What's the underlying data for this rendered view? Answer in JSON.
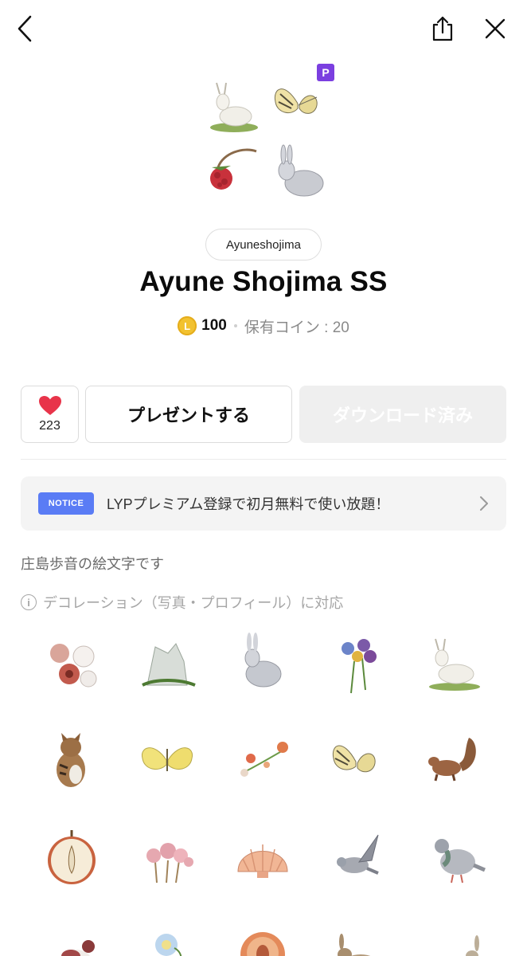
{
  "topbar": {
    "back_icon": "chevron-left-icon",
    "share_icon": "share-icon",
    "close_icon": "close-icon"
  },
  "hero": {
    "images": [
      "white-goat-sticker",
      "butterfly-sticker",
      "raspberry-sticker",
      "rabbit-sticker"
    ],
    "premium_badge": "P"
  },
  "author": "Ayuneshojima",
  "title": "Ayune Shojima SS",
  "price": {
    "coin_symbol": "L",
    "amount": "100",
    "owned": "保有コイン : 20"
  },
  "actions": {
    "like_count": "223",
    "present_label": "プレゼントする",
    "download_label": "ダウンロード済み"
  },
  "notice": {
    "badge": "NOTICE",
    "text": "LYPプレミアム登録で初月無料で使い放題！"
  },
  "description": "庄島歩音の絵文字です",
  "decoration": {
    "icon": "info-icon",
    "text": "デコレーション（写真・プロフィール）に対応"
  },
  "emoji_grid": [
    "flowers-emoji",
    "doves-emoji",
    "rabbit-emoji",
    "pansy-emoji",
    "goat-emoji",
    "cat-emoji",
    "yellow-butterfly-emoji",
    "flower-sprig-emoji",
    "swallowtail-emoji",
    "squirrel-emoji",
    "apple-emoji",
    "pink-flowers-emoji",
    "shell-emoji",
    "pigeon-flying-emoji",
    "pigeon-emoji",
    "red-bird-emoji",
    "blue-flower-emoji",
    "peach-emoji",
    "hare-emoji",
    "hare-running-emoji"
  ],
  "colors": {
    "premium": "#7b3fe0",
    "coin": "#f2c230",
    "notice": "#5a7cf5",
    "heart": "#e8344a"
  }
}
